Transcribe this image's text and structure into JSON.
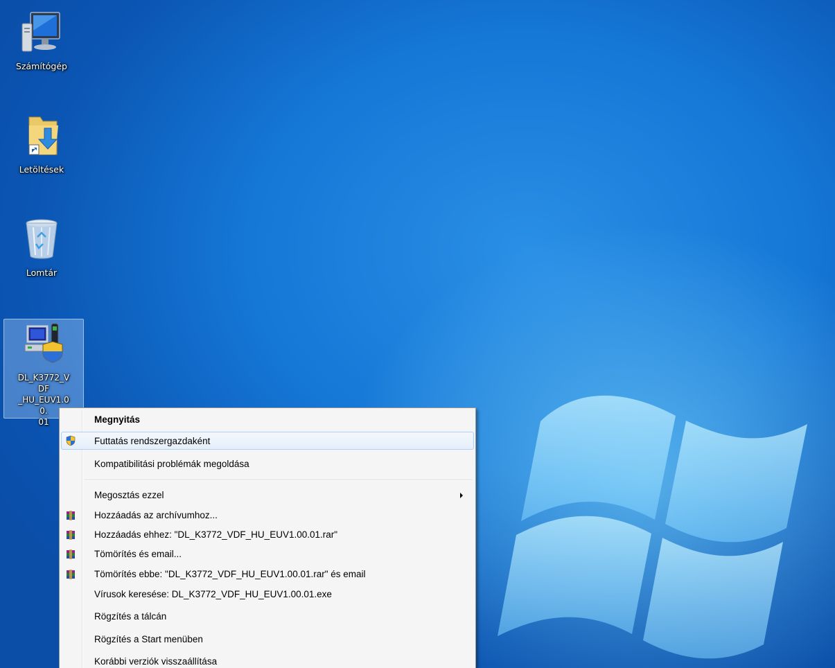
{
  "desktop": {
    "icons": [
      {
        "label": "Számítógép",
        "icon": "computer-icon"
      },
      {
        "label": "Letöltések",
        "icon": "downloads-folder-icon"
      },
      {
        "label": "Lomtár",
        "icon": "recycle-bin-icon"
      },
      {
        "label": "DL_K3772_VDF_HU_EUV1.00.01",
        "label_lines": [
          "DL_K3772_VDF",
          "_HU_EUV1.00.",
          "01"
        ],
        "icon": "installer-shield-icon",
        "selected": true
      }
    ],
    "wallpaper": {
      "accent": "#1577d6",
      "highlight": "#8ce1ff"
    }
  },
  "context_menu": {
    "items": [
      {
        "label": "Megnyitás",
        "bold": true
      },
      {
        "label": "Futtatás rendszergazdaként",
        "icon": "uac-shield-icon",
        "highlighted": true
      },
      {
        "label": "Kompatibilitási problémák megoldása"
      },
      {
        "label": "Megosztás ezzel",
        "submenu": true
      },
      {
        "label": "Hozzáadás az archívumhoz...",
        "icon": "winrar-icon"
      },
      {
        "label": "Hozzáadás ehhez: \"DL_K3772_VDF_HU_EUV1.00.01.rar\"",
        "icon": "winrar-icon"
      },
      {
        "label": "Tömörítés és email...",
        "icon": "winrar-icon"
      },
      {
        "label": "Tömörítés ebbe: \"DL_K3772_VDF_HU_EUV1.00.01.rar\" és email",
        "icon": "winrar-icon"
      },
      {
        "label": "Vírusok keresése: DL_K3772_VDF_HU_EUV1.00.01.exe"
      },
      {
        "label": "Rögzítés a tálcán"
      },
      {
        "label": "Rögzítés a Start menüben"
      },
      {
        "label": "Korábbi verziók visszaállítása"
      }
    ],
    "colors": {
      "background": "#f5f5f5",
      "highlight_border": "#aecff7"
    }
  }
}
